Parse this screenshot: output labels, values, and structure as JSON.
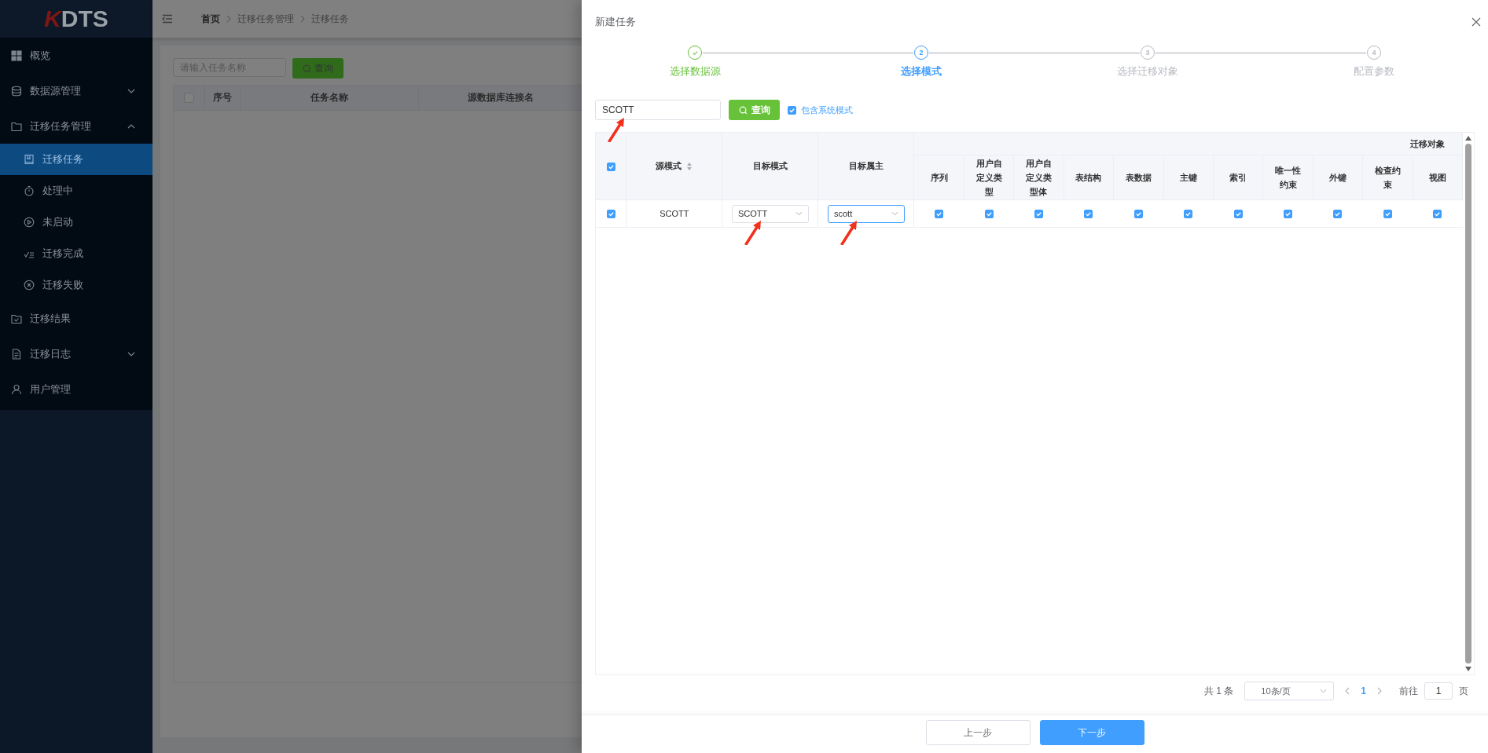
{
  "sidebar": {
    "logo": {
      "mark": "K",
      "name": "DTS"
    },
    "items": [
      {
        "label": "概览",
        "selected": false
      },
      {
        "label": "数据源管理",
        "selected": false,
        "expanded": false
      },
      {
        "label": "迁移任务管理",
        "selected": false,
        "expanded": true,
        "children": [
          {
            "label": "迁移任务",
            "selected": true
          },
          {
            "label": "处理中",
            "selected": false
          },
          {
            "label": "未启动",
            "selected": false
          },
          {
            "label": "迁移完成",
            "selected": false
          },
          {
            "label": "迁移失败",
            "selected": false
          }
        ]
      },
      {
        "label": "迁移结果",
        "selected": false
      },
      {
        "label": "迁移日志",
        "selected": false,
        "expanded": false
      },
      {
        "label": "用户管理",
        "selected": false
      }
    ]
  },
  "breadcrumb": [
    "首页",
    "迁移任务管理",
    "迁移任务"
  ],
  "task_list": {
    "search": {
      "placeholder": "请输入任务名称"
    },
    "search_button": "查询",
    "select_all": {
      "checked": false
    },
    "columns": [
      "序号",
      "任务名称",
      "源数据库连接名"
    ]
  },
  "drawer": {
    "title": "新建任务",
    "steps": [
      {
        "label": "选择数据源",
        "done": true,
        "selected": false
      },
      {
        "label": "选择模式",
        "number": "2",
        "done": false,
        "selected": true
      },
      {
        "label": "选择迁移对象",
        "number": "3",
        "done": false,
        "selected": false
      },
      {
        "label": "配置参数",
        "number": "4",
        "done": false,
        "selected": false
      }
    ],
    "filter": {
      "search": {
        "value": "SCOTT",
        "arrow": true
      },
      "button": "查询",
      "include_system": {
        "label": "包含系统模式",
        "checked": true
      }
    },
    "table": {
      "select_all": {
        "checked": true
      },
      "columns": [
        {
          "label": "源模式",
          "sortable": true
        },
        {
          "label": "目标模式"
        },
        {
          "label": "目标属主"
        }
      ],
      "group": {
        "label": "迁移对象",
        "columns": [
          "序列",
          "用户自定义类型",
          "用户自定义类型体",
          "表结构",
          "表数据",
          "主键",
          "索引",
          "唯一性约束",
          "外键",
          "检查约束",
          "视图"
        ]
      },
      "rows": [
        {
          "checked": true,
          "source": "SCOTT",
          "target_schema": {
            "value": "SCOTT",
            "focused": false,
            "arrow": true
          },
          "target_owner": {
            "value": "scott",
            "focused": true,
            "arrow": true
          },
          "objects": [
            true,
            true,
            true,
            true,
            true,
            true,
            true,
            true,
            true,
            true,
            true
          ]
        }
      ]
    },
    "pagination": {
      "total": "共 1 条",
      "page_size": "10条/页",
      "pages": [
        {
          "label": "1",
          "selected": true
        }
      ],
      "goto_label": "前往",
      "goto_value": "1",
      "goto_suffix": "页"
    },
    "buttons": [
      {
        "label": "上一步",
        "kind": "default"
      },
      {
        "label": "下一步",
        "kind": "primary"
      }
    ]
  }
}
